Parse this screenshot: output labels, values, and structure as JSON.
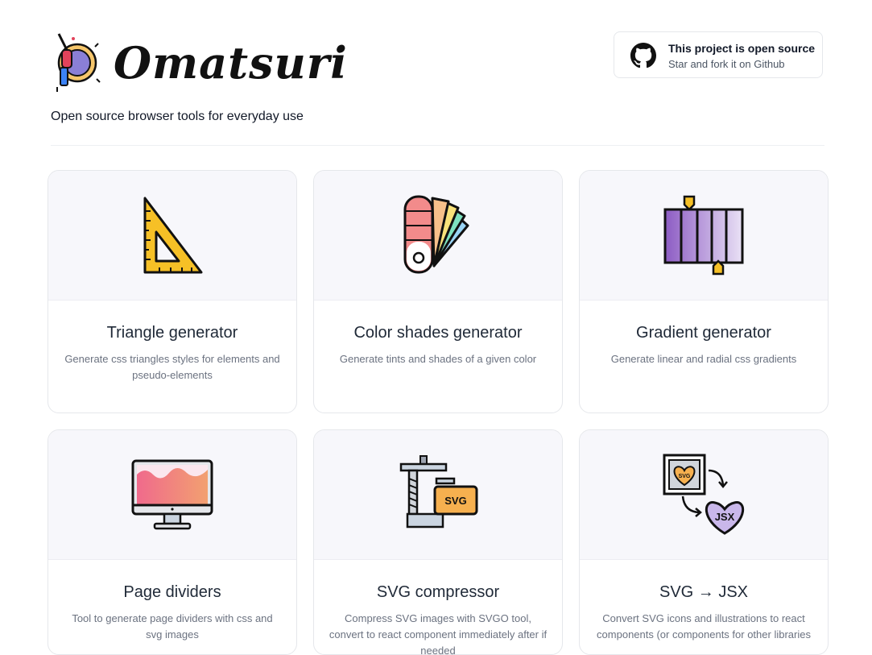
{
  "header": {
    "brand": "Omatsuri",
    "tagline": "Open source browser tools for everyday use",
    "github": {
      "title": "This project is open source",
      "subtitle": "Star and fork it on Github"
    }
  },
  "cards": [
    {
      "title": "Triangle generator",
      "description": "Generate css triangles styles for elements and pseudo-elements",
      "icon": "triangle-ruler-icon"
    },
    {
      "title": "Color shades generator",
      "description": "Generate tints and shades of a given color",
      "icon": "color-palette-icon"
    },
    {
      "title": "Gradient generator",
      "description": "Generate linear and radial css gradients",
      "icon": "gradient-icon"
    },
    {
      "title": "Page dividers",
      "description": "Tool to generate page dividers with css and svg images",
      "icon": "monitor-icon"
    },
    {
      "title": "SVG compressor",
      "description": "Compress SVG images with SVGO tool, convert to react component immediately after if needed",
      "svg_label": "SVG",
      "icon": "clamp-icon"
    },
    {
      "title": "SVG → JSX",
      "description": "Convert SVG icons and illustrations to react components (or components for other libraries",
      "svg_label": "SVG",
      "jsx_label": "JSX",
      "icon": "svg-to-jsx-icon"
    }
  ],
  "colors": {
    "card_art_bg": "#f7f7fb",
    "border": "#e5e7eb",
    "muted_text": "#6b7280"
  }
}
